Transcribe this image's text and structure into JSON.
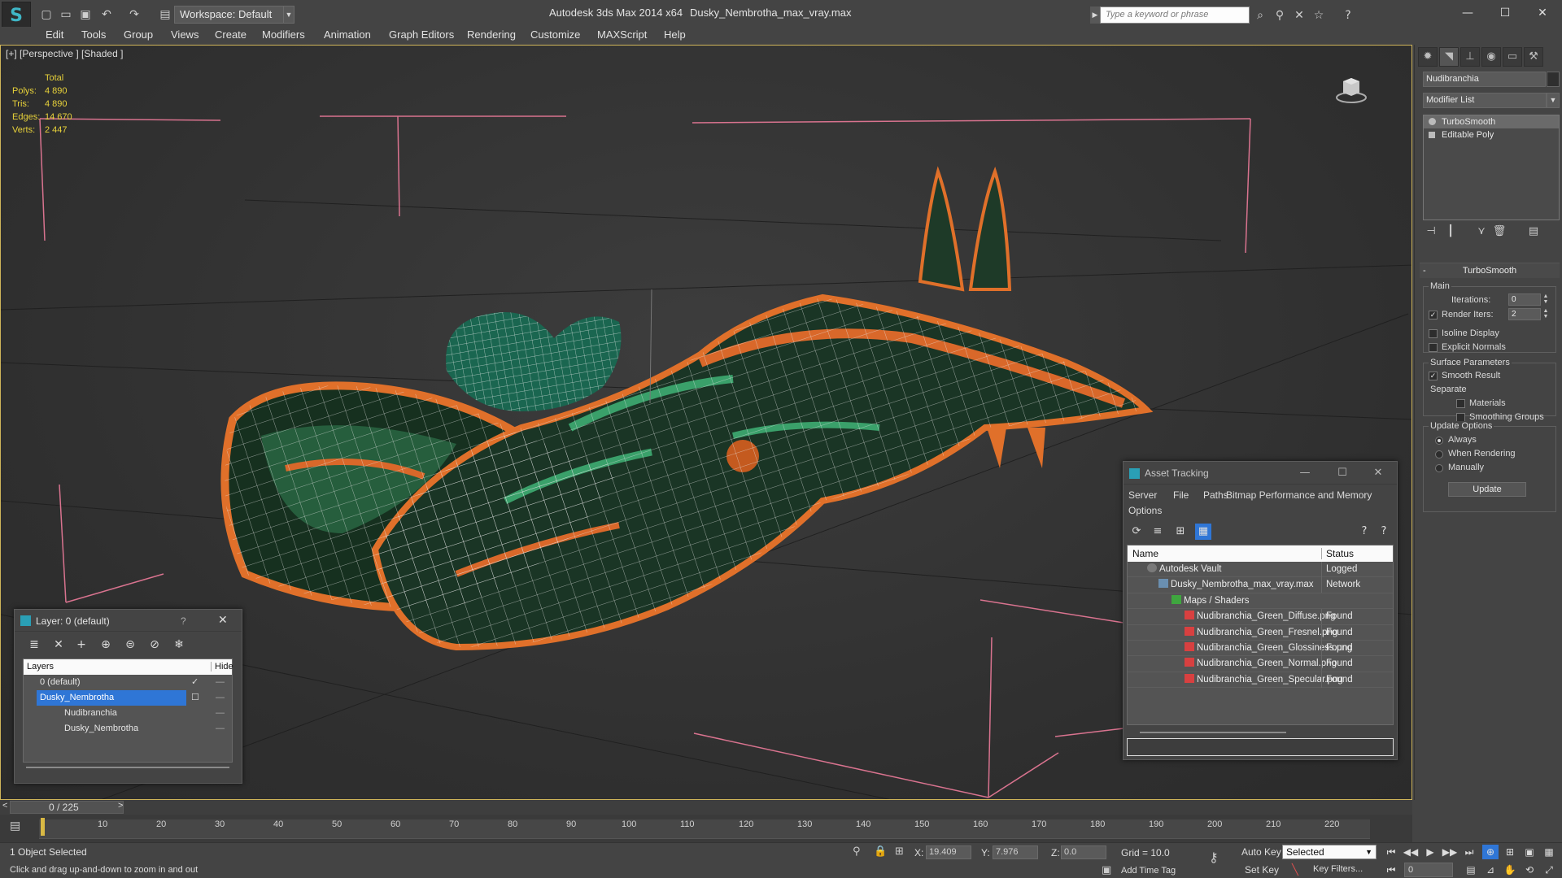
{
  "titlebar": {
    "app_title": "Autodesk 3ds Max  2014 x64",
    "file_title": "Dusky_Nembrotha_max_vray.max",
    "workspace": "Workspace: Default",
    "search_placeholder": "Type a keyword or phrase"
  },
  "menu": [
    "Edit",
    "Tools",
    "Group",
    "Views",
    "Create",
    "Modifiers",
    "Animation",
    "Graph Editors",
    "Rendering",
    "Customize",
    "MAXScript",
    "Help"
  ],
  "viewport": {
    "label": "[+] [Perspective ] [Shaded ]",
    "stats": {
      "header": "Total",
      "rows": [
        {
          "label": "Polys:",
          "value": "4 890"
        },
        {
          "label": "Tris:",
          "value": "4 890"
        },
        {
          "label": "Edges:",
          "value": "14 670"
        },
        {
          "label": "Verts:",
          "value": "2 447"
        }
      ]
    }
  },
  "command_panel": {
    "object_name": "Nudibranchia",
    "modifier_list": "Modifier List",
    "stack": [
      "TurboSmooth",
      "Editable Poly"
    ],
    "turbosmooth": {
      "title": "TurboSmooth",
      "main_label": "Main",
      "iterations_label": "Iterations:",
      "iterations_value": "0",
      "render_iters_label": "Render Iters:",
      "render_iters_value": "2",
      "isoline_label": "Isoline Display",
      "explicit_label": "Explicit Normals",
      "surface_label": "Surface Parameters",
      "smooth_label": "Smooth Result",
      "separate_label": "Separate",
      "materials_label": "Materials",
      "smoothing_groups_label": "Smoothing Groups",
      "update_options_label": "Update Options",
      "always_label": "Always",
      "when_rendering_label": "When Rendering",
      "manually_label": "Manually",
      "update_button": "Update"
    }
  },
  "layer_dialog": {
    "title": "Layer: 0 (default)",
    "help": "?",
    "col_layers": "Layers",
    "col_hide": "Hide",
    "rows": [
      {
        "name": "0 (default)"
      },
      {
        "name": "Dusky_Nembrotha"
      },
      {
        "name": "Nudibranchia"
      },
      {
        "name": "Dusky_Nembrotha"
      }
    ]
  },
  "asset_dialog": {
    "title": "Asset Tracking",
    "menu": [
      "Server",
      "File",
      "Paths",
      "Bitmap Performance and Memory",
      "Options"
    ],
    "col_name": "Name",
    "col_status": "Status",
    "rows": [
      {
        "name": "Autodesk Vault",
        "status": "Logged"
      },
      {
        "name": "Dusky_Nembrotha_max_vray.max",
        "status": "Network"
      },
      {
        "name": "Maps / Shaders",
        "status": ""
      },
      {
        "name": "Nudibranchia_Green_Diffuse.png",
        "status": "Found"
      },
      {
        "name": "Nudibranchia_Green_Fresnel.png",
        "status": "Found"
      },
      {
        "name": "Nudibranchia_Green_Glossiness.png",
        "status": "Found"
      },
      {
        "name": "Nudibranchia_Green_Normal.png",
        "status": "Found"
      },
      {
        "name": "Nudibranchia_Green_Specular.png",
        "status": "Found"
      }
    ]
  },
  "timeline": {
    "frame_label": "0 / 225",
    "ticks": [
      "10",
      "20",
      "30",
      "40",
      "50",
      "60",
      "70",
      "80",
      "90",
      "100",
      "110",
      "120",
      "130",
      "140",
      "150",
      "160",
      "170",
      "180",
      "190",
      "200",
      "210",
      "220"
    ]
  },
  "status": {
    "selection": "1 Object Selected",
    "prompt": "Click and drag up-and-down to zoom in and out",
    "x_label": "X:",
    "x_value": "19.409",
    "y_label": "Y:",
    "y_value": "7.976",
    "z_label": "Z:",
    "z_value": "0.0",
    "grid": "Grid = 10.0",
    "add_time_tag": "Add Time Tag",
    "auto_key": "Auto Key",
    "set_key": "Set Key",
    "selected_dropdown": "Selected",
    "key_filters": "Key Filters...",
    "frame": "0"
  },
  "colors": {
    "accent": "#2f76d6",
    "viewport_border": "#cfb55a",
    "stats_text": "#e8d23a"
  }
}
